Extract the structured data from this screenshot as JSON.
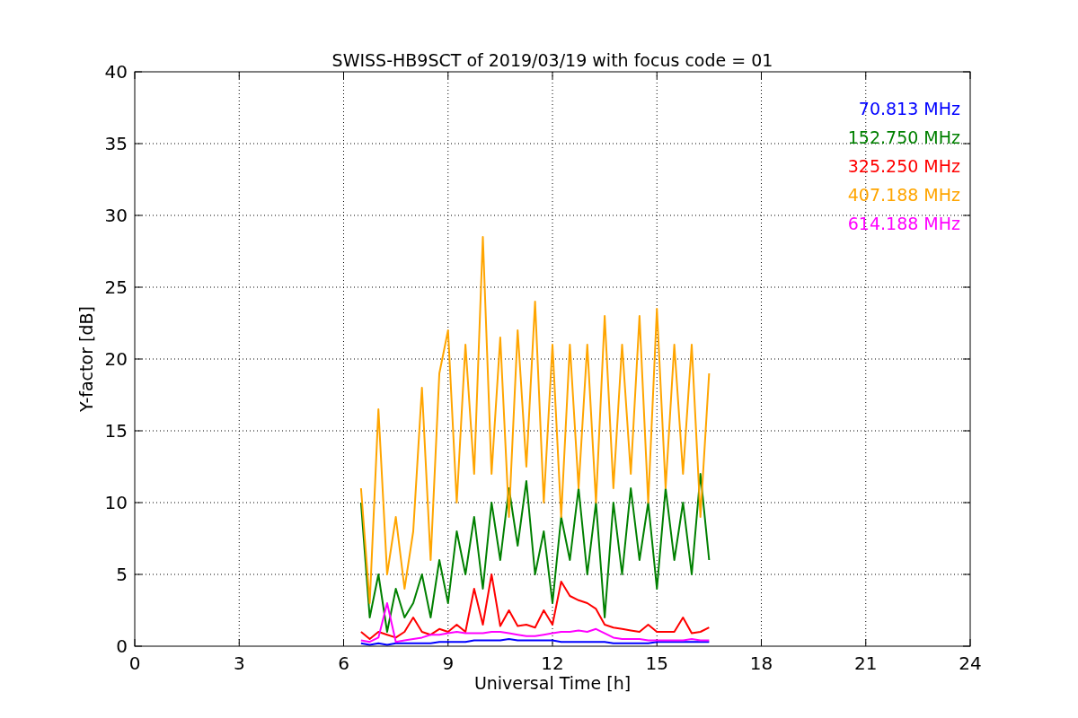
{
  "chart_data": {
    "type": "line",
    "title": "SWISS-HB9SCT of 2019/03/19 with focus code = 01",
    "xlabel": "Universal Time [h]",
    "ylabel": "Y-factor [dB]",
    "x": [
      6.5,
      6.75,
      7,
      7.25,
      7.5,
      7.75,
      8,
      8.25,
      8.5,
      8.75,
      9,
      9.25,
      9.5,
      9.75,
      10,
      10.25,
      10.5,
      10.75,
      11,
      11.25,
      11.5,
      11.75,
      12,
      12.25,
      12.5,
      12.75,
      13,
      13.25,
      13.5,
      13.75,
      14,
      14.25,
      14.5,
      14.75,
      15,
      15.25,
      15.5,
      15.75,
      16,
      16.25,
      16.5
    ],
    "series": [
      {
        "name": "70.813 MHz",
        "color": "#0000ff",
        "values": [
          0.2,
          0.1,
          0.2,
          0.1,
          0.2,
          0.2,
          0.2,
          0.2,
          0.2,
          0.3,
          0.3,
          0.3,
          0.3,
          0.4,
          0.4,
          0.4,
          0.4,
          0.5,
          0.4,
          0.4,
          0.4,
          0.4,
          0.4,
          0.3,
          0.3,
          0.3,
          0.3,
          0.3,
          0.3,
          0.2,
          0.2,
          0.2,
          0.2,
          0.2,
          0.3,
          0.3,
          0.3,
          0.3,
          0.3,
          0.3,
          0.3
        ]
      },
      {
        "name": "152.750 MHz",
        "color": "#008000",
        "values": [
          10,
          2,
          5,
          1,
          4,
          2,
          3,
          5,
          2,
          6,
          3,
          8,
          5,
          9,
          4,
          10,
          6,
          11,
          7,
          11.5,
          5,
          8,
          3,
          9,
          6,
          11,
          5,
          10,
          2,
          10,
          5,
          11,
          6,
          10,
          4,
          11,
          6,
          10,
          5,
          12,
          6
        ]
      },
      {
        "name": "325.250 MHz",
        "color": "#ff0000",
        "values": [
          1,
          0.5,
          1,
          0.8,
          0.6,
          1,
          2,
          1,
          0.8,
          1.2,
          1,
          1.5,
          1,
          4,
          1.5,
          5,
          1.4,
          2.5,
          1.4,
          1.5,
          1.3,
          2.5,
          1.5,
          4.5,
          3.5,
          3.2,
          3,
          2.6,
          1.5,
          1.3,
          1.2,
          1.1,
          1,
          1.5,
          1,
          1,
          1,
          2,
          0.9,
          1,
          1.3
        ]
      },
      {
        "name": "407.188 MHz",
        "color": "#ffa500",
        "values": [
          11,
          3,
          16.5,
          5,
          9,
          4,
          8,
          18,
          6,
          19,
          22,
          10,
          21,
          12,
          28.5,
          12,
          21.5,
          9,
          22,
          12.5,
          24,
          10,
          21,
          9,
          21,
          11,
          21,
          10,
          23,
          11,
          21,
          12,
          23,
          10,
          23.5,
          11,
          21,
          12,
          21,
          9,
          19
        ]
      },
      {
        "name": "614.188 MHz",
        "color": "#ff00ff",
        "values": [
          0.4,
          0.3,
          0.6,
          3,
          0.3,
          0.4,
          0.5,
          0.6,
          0.8,
          0.8,
          0.9,
          1,
          0.9,
          0.9,
          0.9,
          1,
          1,
          0.9,
          0.8,
          0.7,
          0.7,
          0.8,
          0.9,
          1,
          1,
          1.1,
          1,
          1.2,
          0.9,
          0.6,
          0.5,
          0.5,
          0.5,
          0.4,
          0.4,
          0.4,
          0.4,
          0.4,
          0.5,
          0.4,
          0.4
        ]
      }
    ],
    "grid": true,
    "xlim": [
      0,
      24
    ],
    "ylim": [
      0,
      40
    ],
    "xticks": [
      0,
      3,
      6,
      9,
      12,
      15,
      18,
      21,
      24
    ],
    "yticks": [
      0,
      5,
      10,
      15,
      20,
      25,
      30,
      35,
      40
    ]
  }
}
